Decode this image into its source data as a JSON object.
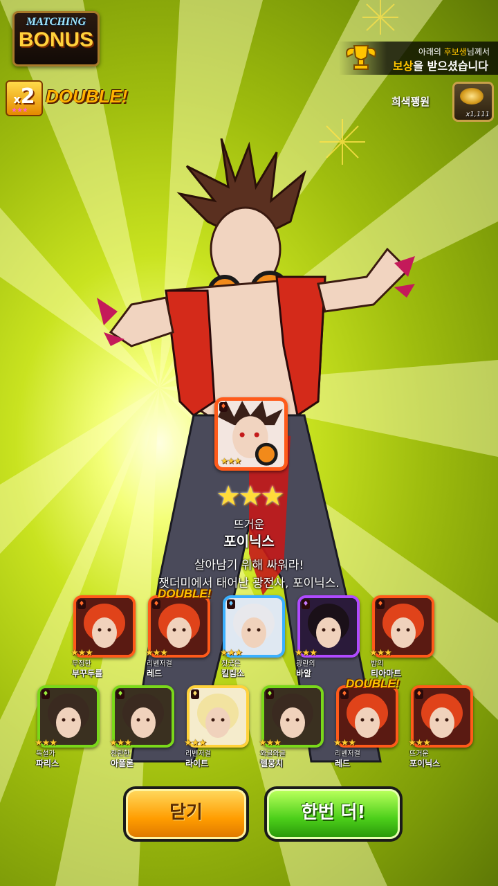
{
  "logo": {
    "line1": "MATCHING",
    "line2": "BONUS"
  },
  "double_badge": {
    "multiplier": "2",
    "x": "x",
    "word": "DOUBLE!",
    "stars": "★★★"
  },
  "notice": {
    "line1_pre": "아래의 ",
    "line1_hl": "후보생",
    "line1_post": "님께서",
    "line2_hl": "보상",
    "line2_post": "을 받으셨습니다"
  },
  "reward": {
    "label": "희색꽹원",
    "qty": "x1,111",
    "icon": "gold-coin-icon"
  },
  "featured": {
    "stars": "★★★",
    "big_stars": "★★★",
    "title": "뜨거운",
    "name": "포이닉스",
    "desc1": "살아남기 위해 싸워라!",
    "desc2": "잿더미에서 태어난 광전사, 포이닉스."
  },
  "row1": [
    {
      "title": "무정한",
      "name": "부꾸두를",
      "stars": "★★★",
      "element": "fire",
      "double": ""
    },
    {
      "title": "리벤저걸",
      "name": "레드",
      "stars": "★★★",
      "element": "fire",
      "double": "DOUBLE!"
    },
    {
      "title": "칫굿은",
      "name": "킬림소",
      "stars": "★★★",
      "element": "water",
      "double": ""
    },
    {
      "title": "광란의",
      "name": "바알",
      "stars": "★★★",
      "element": "dark",
      "double": ""
    },
    {
      "title": "밤의",
      "name": "티아마트",
      "stars": "★★★",
      "element": "fire",
      "double": ""
    }
  ],
  "row2": [
    {
      "title": "독설가",
      "name": "파리스",
      "stars": "★★★",
      "element": "wood",
      "double": ""
    },
    {
      "title": "찬란한",
      "name": "아폴론",
      "stars": "★★★",
      "element": "wood",
      "double": ""
    },
    {
      "title": "리벤저걸",
      "name": "라이트",
      "stars": "★★★",
      "element": "light",
      "double": ""
    },
    {
      "title": "와글와글",
      "name": "렐뭉치",
      "stars": "★★★",
      "element": "wood",
      "double": ""
    },
    {
      "title": "리벤저걸",
      "name": "레드",
      "stars": "★★★",
      "element": "fire",
      "double": "DOUBLE!"
    },
    {
      "title": "뜨거운",
      "name": "포이닉스",
      "stars": "★★★",
      "element": "fire",
      "double": ""
    }
  ],
  "buttons": {
    "close": "닫기",
    "again": "한번 더!"
  },
  "colors": {
    "background": "#c9e320",
    "fire": "#ff5a1a",
    "water": "#3ab0ff",
    "dark": "#b04aff",
    "wood": "#7ad81a",
    "light": "#ffd23a",
    "close_button": "#ff9d00",
    "again_button": "#4ccf1a"
  }
}
